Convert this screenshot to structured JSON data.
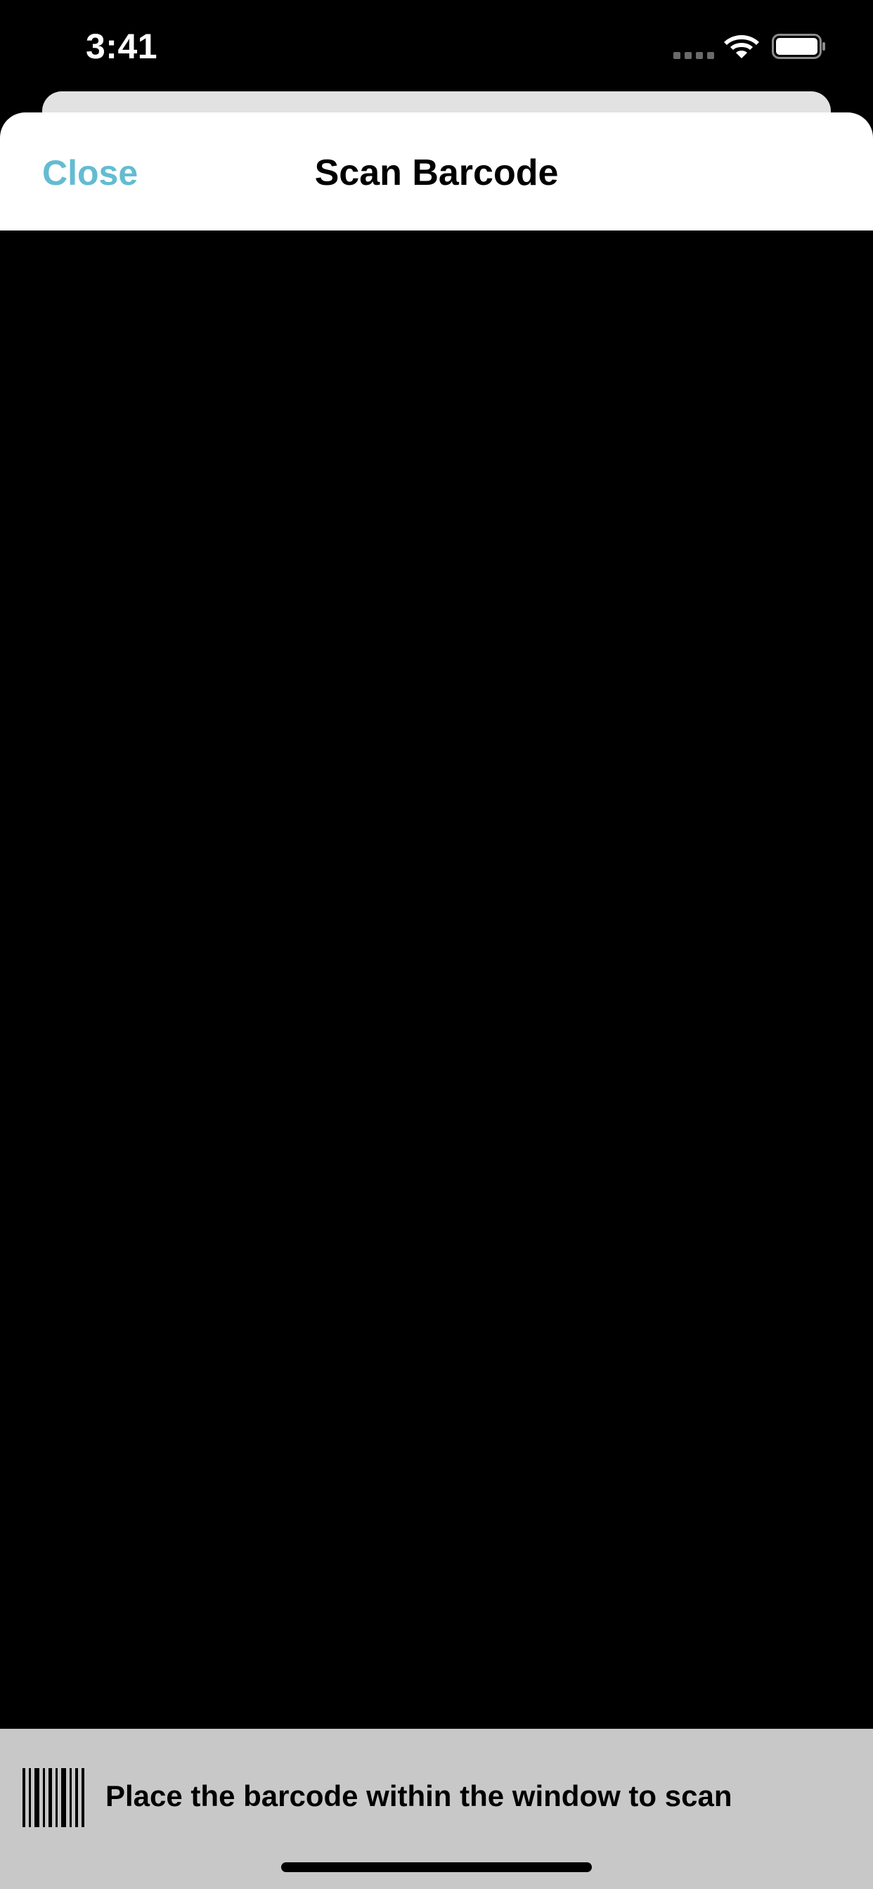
{
  "status_bar": {
    "time": "3:41",
    "signal_icon": "cellular-signal-icon",
    "wifi_icon": "wifi-icon",
    "battery_icon": "battery-full-icon",
    "battery_level": 1.0
  },
  "header": {
    "close_label": "Close",
    "title": "Scan Barcode"
  },
  "instruction": {
    "icon": "barcode-icon",
    "text": "Place the barcode within the window to scan"
  },
  "colors": {
    "accent": "#63bcd1",
    "instruction_bar": "#c8c8c8",
    "camera_background": "#000000"
  }
}
